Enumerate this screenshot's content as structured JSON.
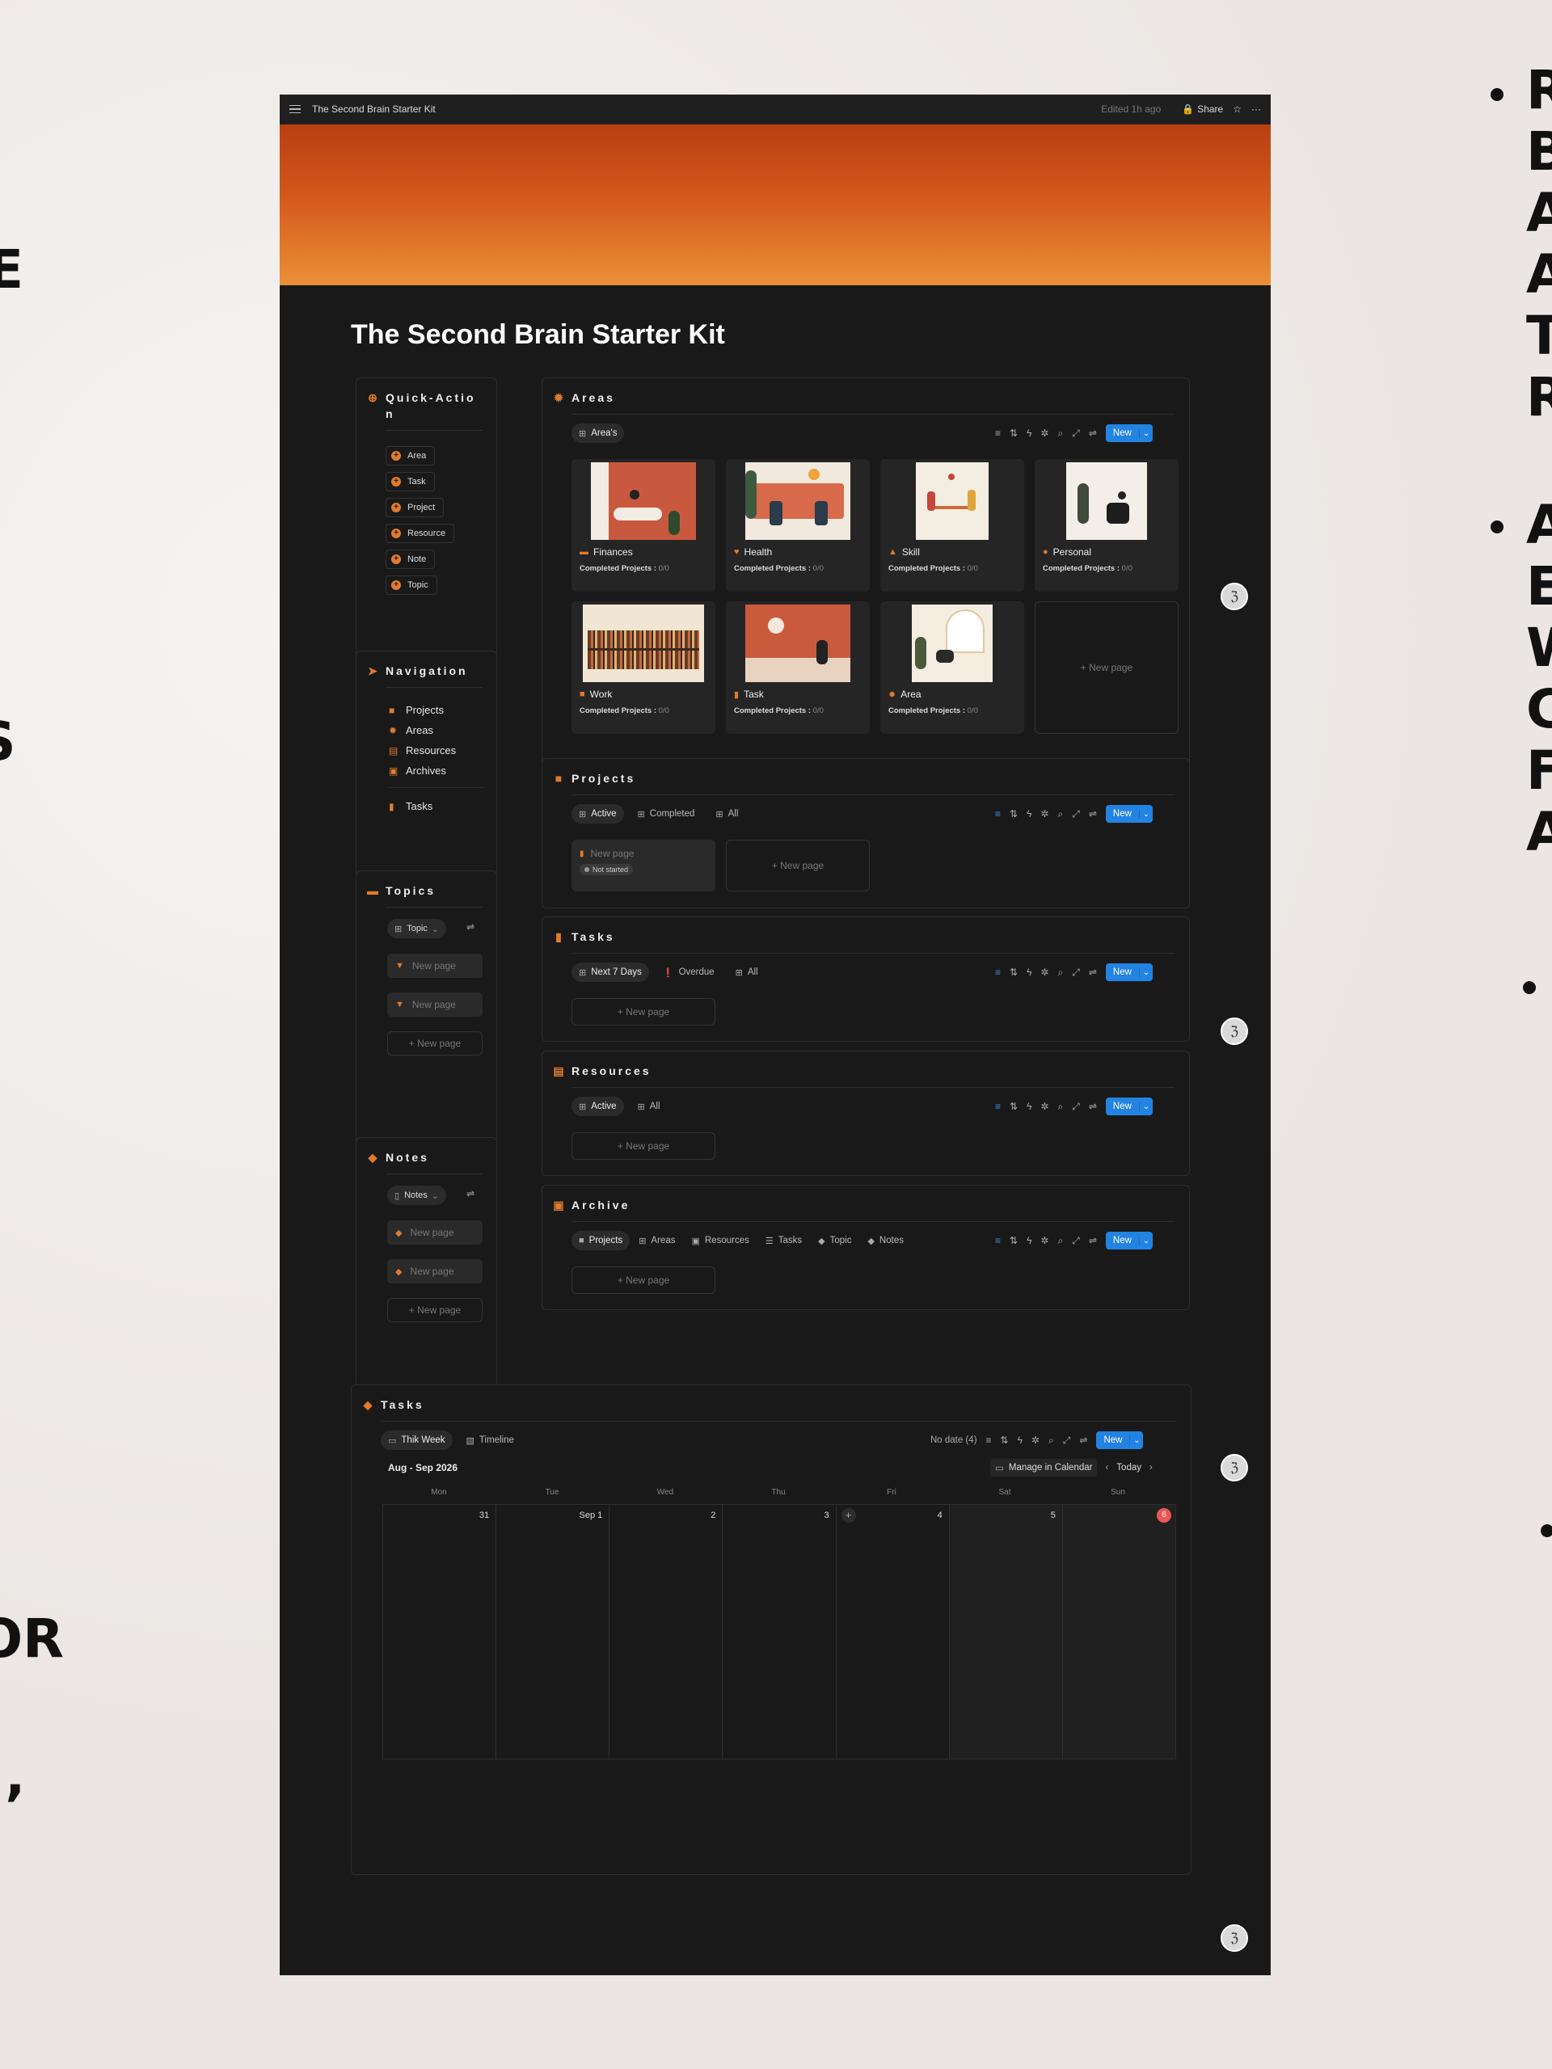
{
  "backdrop": {
    "left_fragments": [
      "E",
      "S",
      "OR",
      "',"
    ],
    "right_fragments": [
      "R",
      "B",
      "A",
      "A",
      "T",
      "R",
      "A",
      "E",
      "W",
      "C",
      "F",
      "A"
    ]
  },
  "window": {
    "breadcrumb": "The Second Brain Starter Kit",
    "edited": "Edited 1h ago",
    "share": "Share",
    "more": "···",
    "page_title": "The Second Brain Starter Kit"
  },
  "quick_action": {
    "title_line1": "Quick-Actio",
    "title_line2": "n",
    "buttons": [
      "Area",
      "Task",
      "Project",
      "Resource",
      "Note",
      "Topic"
    ]
  },
  "navigation": {
    "title": "Navigation",
    "items": [
      {
        "label": "Projects",
        "icon": "briefcase-icon"
      },
      {
        "label": "Areas",
        "icon": "gear-icon"
      },
      {
        "label": "Resources",
        "icon": "stack-icon"
      },
      {
        "label": "Archives",
        "icon": "archive-icon"
      }
    ],
    "tasks": "Tasks"
  },
  "topics": {
    "title": "Topics",
    "view": "Topic",
    "rows": [
      "New page",
      "New page"
    ],
    "add": "+ New page"
  },
  "notes": {
    "title": "Notes",
    "view": "Notes",
    "rows": [
      "New page",
      "New page"
    ],
    "add": "+ New page"
  },
  "areas": {
    "title": "Areas",
    "tab": "Area's",
    "new_label": "New",
    "cards": [
      {
        "name": "Finances",
        "completed_label": "Completed Projects :",
        "completed_value": "0/0"
      },
      {
        "name": "Health",
        "completed_label": "Completed Projects :",
        "completed_value": "0/0"
      },
      {
        "name": "Skill",
        "completed_label": "Completed Projects :",
        "completed_value": "0/0"
      },
      {
        "name": "Personal",
        "completed_label": "Completed Projects :",
        "completed_value": "0/0"
      },
      {
        "name": "Work",
        "completed_label": "Completed Projects :",
        "completed_value": "0/0"
      },
      {
        "name": "Task",
        "completed_label": "Completed Projects :",
        "completed_value": "0/0"
      },
      {
        "name": "Area",
        "completed_label": "Completed Projects :",
        "completed_value": "0/0"
      }
    ],
    "add": "+ New page"
  },
  "projects": {
    "title": "Projects",
    "tabs": [
      "Active",
      "Completed",
      "All"
    ],
    "new_label": "New",
    "card": {
      "name": "New page",
      "status": "Not started"
    },
    "add": "+ New page"
  },
  "tasks_db": {
    "title": "Tasks",
    "tabs": [
      "Next 7 Days",
      "Overdue",
      "All"
    ],
    "new_label": "New",
    "add": "+ New page"
  },
  "resources": {
    "title": "Resources",
    "tabs": [
      "Active",
      "All"
    ],
    "new_label": "New",
    "add": "+ New page"
  },
  "archive": {
    "title": "Archive",
    "tabs": [
      "Projects",
      "Areas",
      "Resources",
      "Tasks",
      "Topic",
      "Notes"
    ],
    "new_label": "New",
    "add": "+ New page"
  },
  "calendar": {
    "title": "Tasks",
    "tabs": [
      "Thik Week",
      "Timeline"
    ],
    "no_date": "No date (4)",
    "new_label": "New",
    "range": "Aug - Sep 2026",
    "manage": "Manage in Calendar",
    "today": "Today",
    "days": [
      "Mon",
      "Tue",
      "Wed",
      "Thu",
      "Fri",
      "Sat",
      "Sun"
    ],
    "dates": [
      "31",
      "Sep 1",
      "2",
      "3",
      "4",
      "5",
      "6"
    ],
    "current_date": "6"
  },
  "colors": {
    "accent": "#e27a2e",
    "blue": "#2383e2",
    "bg": "#191919",
    "today": "#eb5757"
  }
}
